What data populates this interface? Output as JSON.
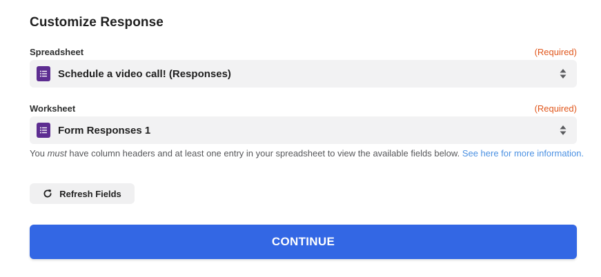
{
  "section": {
    "title": "Customize Response"
  },
  "spreadsheet": {
    "label": "Spreadsheet",
    "required": "(Required)",
    "value": "Schedule a video call! (Responses)",
    "icon": "google-forms-icon"
  },
  "worksheet": {
    "label": "Worksheet",
    "required": "(Required)",
    "value": "Form Responses 1",
    "icon": "google-forms-icon"
  },
  "help": {
    "prefix": "You ",
    "emphasis": "must",
    "suffix": " have column headers and at least one entry in your spreadsheet to view the available fields below. ",
    "link_text": "See here for more information."
  },
  "refresh": {
    "label": "Refresh Fields",
    "icon": "refresh-icon"
  },
  "continue": {
    "label": "CONTINUE"
  },
  "colors": {
    "accent": "#3367e4",
    "required": "#e0561b",
    "link": "#4a90e2",
    "forms_icon": "#5d2d91"
  }
}
